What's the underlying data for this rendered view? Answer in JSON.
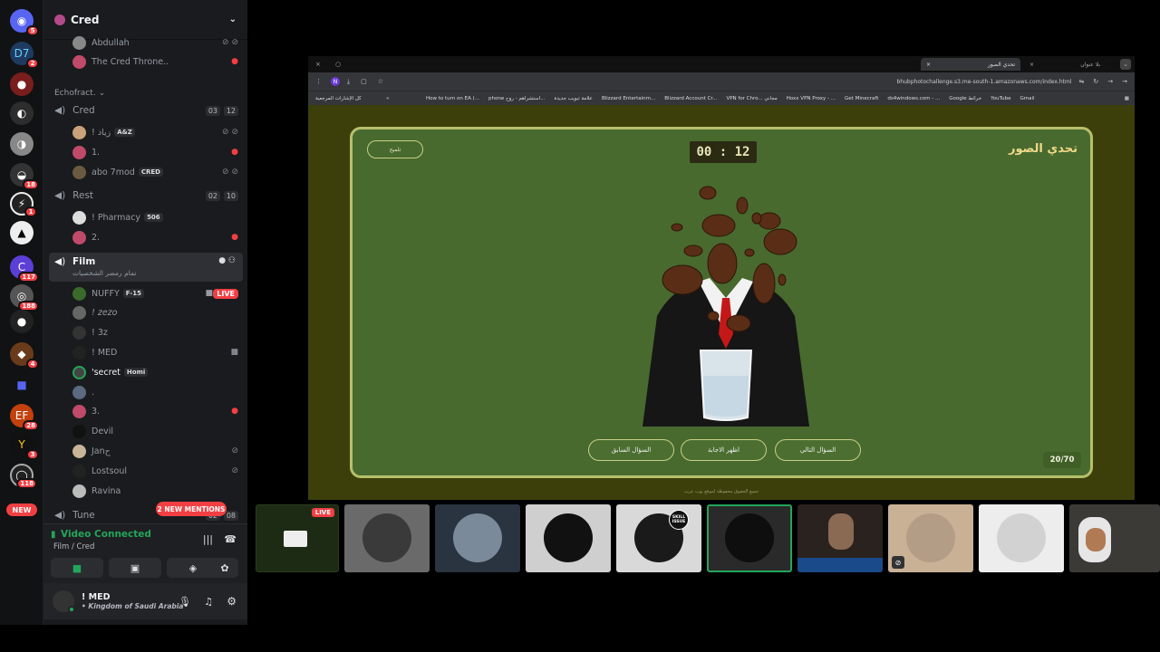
{
  "server_rail": {
    "badges": [
      "5",
      "2",
      "18",
      "1",
      "117",
      "188",
      "4",
      "28",
      "3",
      "118"
    ],
    "new_label": "NEW"
  },
  "sidebar": {
    "guild_name": "Cred",
    "users_top": [
      {
        "name": "Abdullah"
      },
      {
        "name": "The Cred Throne.."
      }
    ],
    "category": "Echofract.",
    "channels": [
      {
        "name": "Cred",
        "counts": [
          "03",
          "12"
        ]
      },
      {
        "name": "Rest",
        "counts": [
          "02",
          "10"
        ]
      },
      {
        "name": "Film",
        "status": "تمام رمضر الشخصيات"
      },
      {
        "name": "Tune",
        "counts": [
          "02",
          "08"
        ]
      }
    ],
    "cred_users": [
      {
        "name": "! زياد",
        "tag": "A&Z"
      },
      {
        "name": "1."
      },
      {
        "name": "abo 7mod",
        "tag": "CRED"
      }
    ],
    "rest_users": [
      {
        "name": "! Pharmacy",
        "tag": "506"
      },
      {
        "name": "2."
      }
    ],
    "film_users": [
      {
        "name": "NUFFY",
        "tag": "F-15",
        "live": "LIVE"
      },
      {
        "name": "! zezo"
      },
      {
        "name": "! 3z"
      },
      {
        "name": "! MED"
      },
      {
        "name": "'secret",
        "tag": "Homi"
      },
      {
        "name": "."
      },
      {
        "name": "3."
      },
      {
        "name": "Devil"
      },
      {
        "name": "Janح"
      },
      {
        "name": "Lostsoul"
      },
      {
        "name": "Ravina"
      }
    ],
    "mentions": "2 NEW MENTIONS"
  },
  "voice": {
    "status": "Video Connected",
    "channel": "Film / Cred"
  },
  "user_panel": {
    "name": "! MED",
    "status": "• Kingdom of Saudi Arabia"
  },
  "browser": {
    "tabs": [
      "تحدي الصور",
      "بلا عنوان"
    ],
    "url": "bhubphotochallenge.s3.me-south-1.amazonaws.com/index.html",
    "bookmarks": [
      "كل الإشارات المرجعية",
      "How to turn on EA (...",
      "phone استشراهم - روح...",
      "علامة تبويب جديدة",
      "Blizzard Entertainm...",
      "Blizzard Account Cr...",
      "VPN for Chro... مجاني",
      "Hoxx VPN Proxy - ...",
      "Get Minecraft",
      "ds4windows.com - ...",
      "Google خرائط",
      "YouTube",
      "Gmail"
    ]
  },
  "game": {
    "title": "تحدي الصور",
    "timer": "00 : 12",
    "small_button": "تلميح",
    "buttons": [
      "السؤال التالي",
      "اظهر الاجابة",
      "السؤال السابق"
    ],
    "counter": "20/70",
    "footer": "جميع الحقوق محفوظة لموقع بوب عرب"
  },
  "video_strip": {
    "live_label": "LIVE",
    "skill_label": "SKILL ISSUE"
  },
  "colors": {
    "discord_bg": "#1a1b1e",
    "game_green": "#486a2e",
    "accent_red": "#f23f43",
    "voice_green": "#23a55a"
  }
}
